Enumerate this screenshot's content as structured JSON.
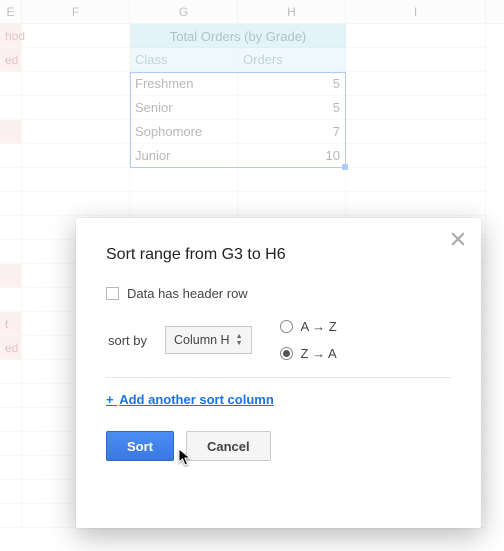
{
  "columns": {
    "E": "E",
    "F": "F",
    "G": "G",
    "H": "H",
    "I": "I"
  },
  "left_fragments": {
    "r1": "hod",
    "r2": "ed"
  },
  "table": {
    "title": "Total Orders (by Grade)",
    "headers": {
      "class": "Class",
      "orders": "Orders"
    },
    "rows": [
      {
        "class": "Freshmen",
        "orders": "5"
      },
      {
        "class": "Senior",
        "orders": "5"
      },
      {
        "class": "Sophomore",
        "orders": "7"
      },
      {
        "class": "Junior",
        "orders": "10"
      }
    ]
  },
  "left_mid": {
    "t": "t",
    "ed": "ed"
  },
  "dialog": {
    "title": "Sort range from G3 to H6",
    "checkbox_label": "Data has header row",
    "sort_by_label": "sort by",
    "column_select": "Column H",
    "radio_az": "A → Z",
    "radio_za": "Z → A",
    "add_link": "Add another sort column",
    "sort_btn": "Sort",
    "cancel_btn": "Cancel"
  }
}
